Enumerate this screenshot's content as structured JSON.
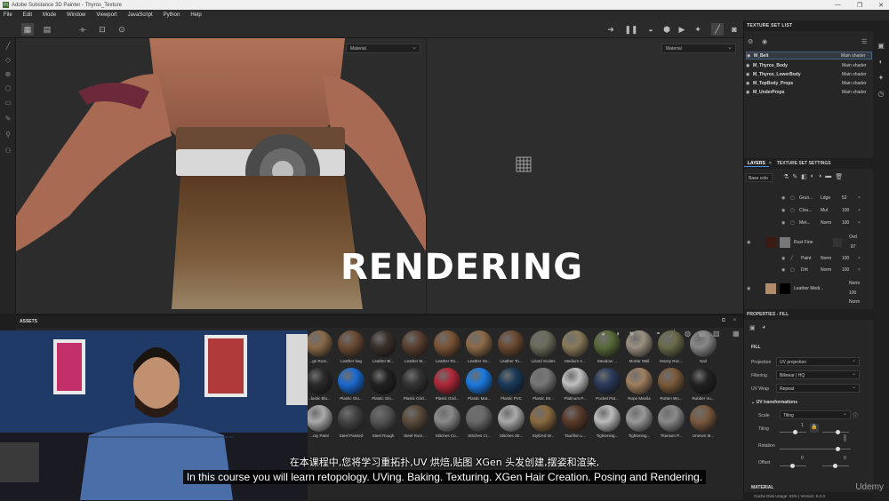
{
  "window": {
    "title": "Adobe Substance 3D Painter - Thyros_Texture",
    "app_icon_text": "Pt"
  },
  "menu": [
    "File",
    "Edit",
    "Mode",
    "Window",
    "Viewport",
    "JavaScript",
    "Python",
    "Help"
  ],
  "viewports": {
    "left_select": "Material",
    "right_select": "Material",
    "overlay_title": "RENDERING"
  },
  "texture_set_list": {
    "title": "TEXTURE SET LIST",
    "items": [
      {
        "name": "M_Belt",
        "shader": "Main shader",
        "selected": true
      },
      {
        "name": "M_Thyros_Body",
        "shader": "Main shader",
        "selected": false
      },
      {
        "name": "M_Thyros_LowerBody",
        "shader": "Main shader",
        "selected": false
      },
      {
        "name": "M_TopBody_Props",
        "shader": "Main shader",
        "selected": false
      },
      {
        "name": "M_UnderProps",
        "shader": "Main shader",
        "selected": false
      }
    ]
  },
  "layers": {
    "tab_layers": "LAYERS",
    "tab_settings": "TEXTURE SET SETTINGS",
    "channel_select": "Base colo",
    "rows": [
      {
        "name": "Grun...",
        "blend": "Ldge",
        "opacity": "52"
      },
      {
        "name": "Clou...",
        "blend": "Mul",
        "opacity": "100"
      },
      {
        "name": "Met...",
        "blend": "Norm",
        "opacity": "100"
      },
      {
        "name": "Rust Fine",
        "blend": "Ovrl",
        "opacity": "87"
      },
      {
        "name": "Paint",
        "blend": "Norm",
        "opacity": "100"
      },
      {
        "name": "Dirt",
        "blend": "Norm",
        "opacity": "100"
      },
      {
        "name": "Leather Medi...",
        "blend": "Norm",
        "opacity": "100"
      },
      {
        "name": "",
        "blend": "Norm",
        "opacity": ""
      }
    ]
  },
  "properties": {
    "title": "PROPERTIES - FILL",
    "section": "FILL",
    "projection_label": "Projection",
    "projection_value": "UV projection",
    "filtering_label": "Filtering",
    "filtering_value": "Bilinear | HQ",
    "uvwrap_label": "UV Wrap",
    "uvwrap_value": "Repeat",
    "uv_transform_label": "UV transformations",
    "scale_label": "Scale",
    "scale_value": "Tiling",
    "tiling_label": "Tiling",
    "tiling_value": "1",
    "tiling_value2": "0",
    "rotation_label": "Rotation",
    "rotation_value": "0",
    "offset_label": "Offset",
    "offset_value": "0",
    "offset_value2": "0",
    "material_label": "MATERIAL"
  },
  "assets": {
    "title": "ASSETS",
    "materials": [
      {
        "label": "...ge Rust...",
        "color": "#8a6a4a"
      },
      {
        "label": "Leather bag",
        "color": "#6b4a34"
      },
      {
        "label": "Leather Bl...",
        "color": "#3a302a"
      },
      {
        "label": "Leather M...",
        "color": "#5a4030"
      },
      {
        "label": "Leather Ro...",
        "color": "#7a5436"
      },
      {
        "label": "Leather So...",
        "color": "#8c6a48"
      },
      {
        "label": "Leather To...",
        "color": "#6a4a30"
      },
      {
        "label": "Lizard Scales",
        "color": "#6b6b5a"
      },
      {
        "label": "Medium A...",
        "color": "#8a7a5a"
      },
      {
        "label": "Meadow ...",
        "color": "#5a6a3a"
      },
      {
        "label": "Mortar Wall",
        "color": "#9a9080"
      },
      {
        "label": "Mossy Roc...",
        "color": "#6a6a4a"
      },
      {
        "label": "Nail",
        "color": "#888888"
      },
      {
        "label": "...lastic Blu...",
        "color": "#2a2a2a"
      },
      {
        "label": "Plastic Glo...",
        "color": "#1a6ad0"
      },
      {
        "label": "Plastic Glo...",
        "color": "#222222"
      },
      {
        "label": "Plastic Grid...",
        "color": "#333333"
      },
      {
        "label": "Plastic Grid...",
        "color": "#b02838"
      },
      {
        "label": "Plastic Mat...",
        "color": "#1a7ae0"
      },
      {
        "label": "Plastic PVC",
        "color": "#1a3a5a"
      },
      {
        "label": "Plastic Str...",
        "color": "#777777"
      },
      {
        "label": "Platinum P...",
        "color": "#c0c0c0"
      },
      {
        "label": "Pocket Pat...",
        "color": "#2a3a5a"
      },
      {
        "label": "Rope Manila",
        "color": "#a08060"
      },
      {
        "label": "Rotten Wo...",
        "color": "#7a5a3a"
      },
      {
        "label": "Rubber Vu...",
        "color": "#222222"
      },
      {
        "label": "...ray Paint",
        "color": "#aaaaaa"
      },
      {
        "label": "Steel Painted",
        "color": "#444444"
      },
      {
        "label": "Steel Rough",
        "color": "#555555"
      },
      {
        "label": "Steel Rust ...",
        "color": "#5a4a3a"
      },
      {
        "label": "Stitches Co...",
        "color": "#8a8a8a"
      },
      {
        "label": "Stitches Cr...",
        "color": "#6a6a6a"
      },
      {
        "label": "Stitches Str...",
        "color": "#aaaaaa"
      },
      {
        "label": "Stylized W...",
        "color": "#8a6a40"
      },
      {
        "label": "Taurillon L...",
        "color": "#5a3a2a"
      },
      {
        "label": "Tightening...",
        "color": "#bbbbbb"
      },
      {
        "label": "Tightening...",
        "color": "#999999"
      },
      {
        "label": "Titanium P...",
        "color": "#8a8a8a"
      },
      {
        "label": "Uneven M...",
        "color": "#7a5a40"
      }
    ]
  },
  "status": {
    "text": "Cache Disk Usage:  63%  |  Version: 8.2.0"
  },
  "subtitles": {
    "cn": "在本课程中,您将学习重拓扑,UV 烘焙,贴图 XGen 头发创建,摆姿和渲染,",
    "en": "In this course you will learn retopology. UVing. Baking. Texturing. XGen Hair Creation. Posing and Rendering."
  },
  "watermark": "Udemy",
  "window_controls": [
    "—",
    "❐",
    "✕"
  ]
}
